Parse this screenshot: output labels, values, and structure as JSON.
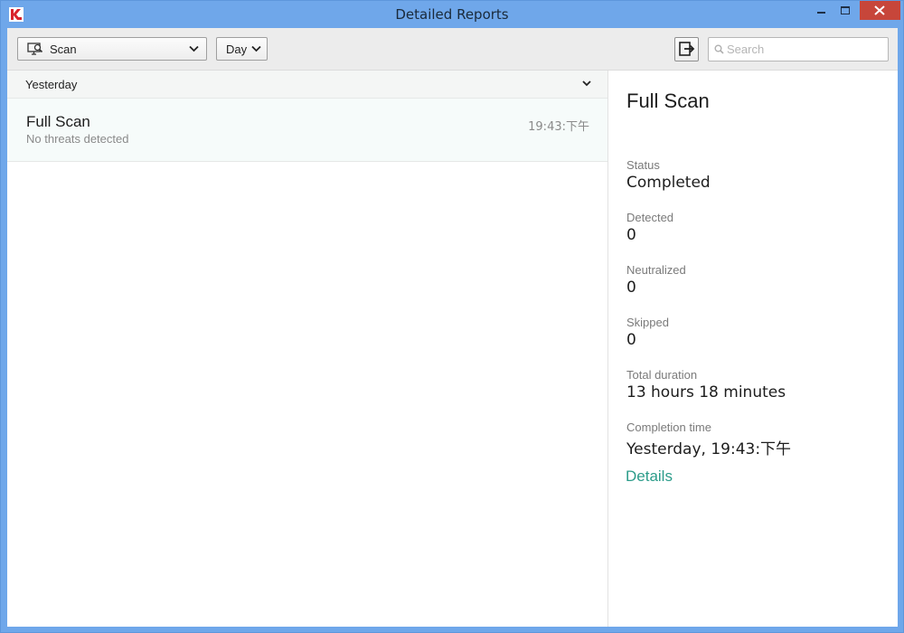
{
  "window": {
    "title": "Detailed Reports"
  },
  "toolbar": {
    "scan_dropdown": "Scan",
    "period_dropdown": "Day",
    "search_placeholder": "Search"
  },
  "list": {
    "group_label": "Yesterday",
    "items": [
      {
        "title": "Full Scan",
        "subtitle": "No threats detected",
        "time": "19:43:下午"
      }
    ]
  },
  "detail": {
    "title": "Full Scan",
    "fields": [
      {
        "label": "Status",
        "value": "Completed"
      },
      {
        "label": "Detected",
        "value": "0"
      },
      {
        "label": "Neutralized",
        "value": "0"
      },
      {
        "label": "Skipped",
        "value": "0"
      },
      {
        "label": "Total duration",
        "value": "13 hours 18 minutes"
      },
      {
        "label": "Completion time",
        "value": "Yesterday, 19:43:下午"
      }
    ],
    "details_link": "Details"
  },
  "colors": {
    "titlebar": "#6fa7ea",
    "close_button": "#c7463a",
    "link": "#2c9c8a",
    "selected_row": "#f6fbfa"
  }
}
